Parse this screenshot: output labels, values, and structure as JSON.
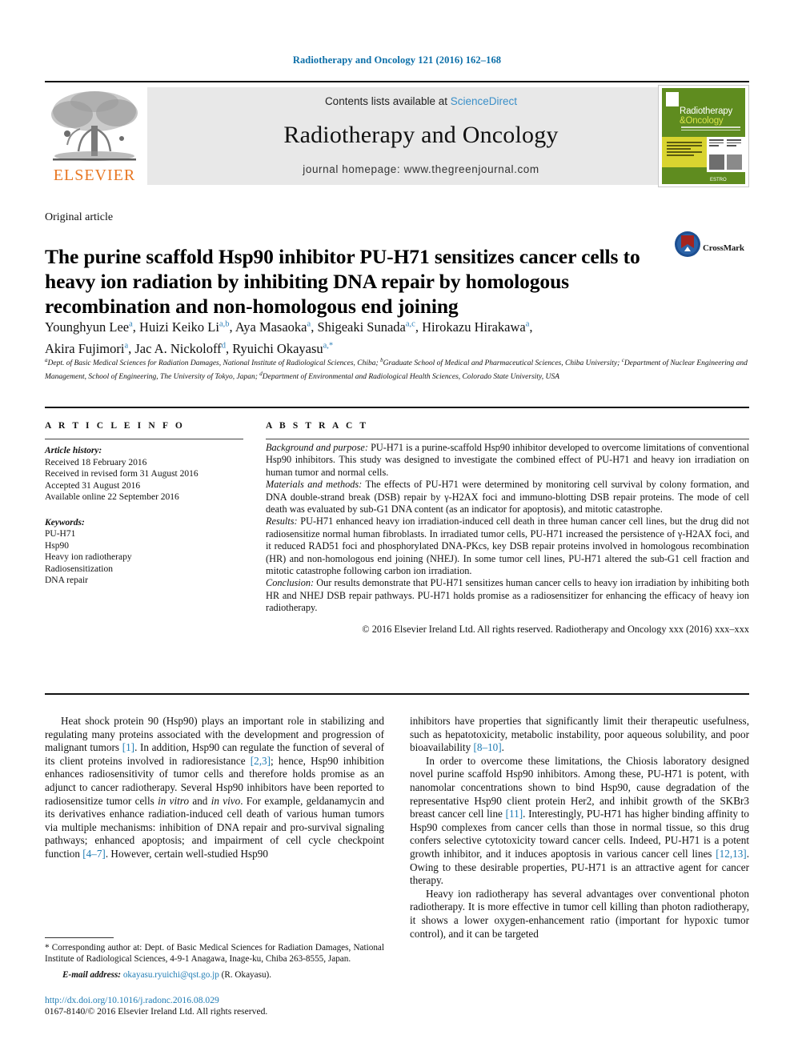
{
  "running_head": "Radiotherapy and Oncology 121 (2016) 162–168",
  "masthead": {
    "publisher_logo_label": "ELSEVIER",
    "contents_prefix": "Contents lists available at ",
    "contents_link": "ScienceDirect",
    "journal_title": "Radiotherapy and Oncology",
    "homepage": "journal homepage: www.thegreenjournal.com",
    "cover": {
      "line1": "Radiotherapy",
      "line2": "&Oncology",
      "footer": "ESTRO"
    }
  },
  "article": {
    "kind": "Original article",
    "title": "The purine scaffold Hsp90 inhibitor PU-H71 sensitizes cancer cells to heavy ion radiation by inhibiting DNA repair by homologous recombination and non-homologous end joining",
    "crossmark_label": "CrossMark",
    "authors_line1": "Younghyun Lee a, Huizi Keiko Li a,b, Aya Masaoka a, Shigeaki Sunada a,c, Hirokazu Hirakawa a,",
    "authors_line2": "Akira Fujimori a, Jac A. Nickoloff d, Ryuichi Okayasu a,*",
    "authors": [
      {
        "name": "Younghyun Lee",
        "marks": "a",
        "sep": ", "
      },
      {
        "name": "Huizi Keiko Li",
        "marks": "a,b",
        "sep": ", "
      },
      {
        "name": "Aya Masaoka",
        "marks": "a",
        "sep": ", "
      },
      {
        "name": "Shigeaki Sunada",
        "marks": "a,c",
        "sep": ", "
      },
      {
        "name": "Hirokazu Hirakawa",
        "marks": "a",
        "sep": ", "
      },
      {
        "name": "Akira Fujimori",
        "marks": "a",
        "sep": ", "
      },
      {
        "name": "Jac A. Nickoloff",
        "marks": "d",
        "sep": ", "
      },
      {
        "name": "Ryuichi Okayasu",
        "marks": "a,*",
        "sep": ""
      }
    ],
    "affiliations": [
      {
        "mark": "a",
        "text": "Dept. of Basic Medical Sciences for Radiation Damages, National Institute of Radiological Sciences, Chiba;"
      },
      {
        "mark": "b",
        "text": "Graduate School of Medical and Pharmaceutical Sciences, Chiba University;"
      },
      {
        "mark": "c",
        "text": "Department of Nuclear Engineering and Management, School of Engineering, The University of Tokyo, Japan;"
      },
      {
        "mark": "d",
        "text": "Department of Environmental and Radiological Health Sciences, Colorado State University, USA"
      }
    ]
  },
  "info": {
    "heading": "A R T I C L E   I N F O",
    "history_label": "Article history:",
    "history": [
      "Received 18 February 2016",
      "Received in revised form 31 August 2016",
      "Accepted 31 August 2016",
      "Available online 22 September 2016"
    ],
    "keywords_label": "Keywords:",
    "keywords": [
      "PU-H71",
      "Hsp90",
      "Heavy ion radiotherapy",
      "Radiosensitization",
      "DNA repair"
    ]
  },
  "abstract": {
    "heading": "A B S T R A C T",
    "background_label": "Background and purpose:",
    "background_text": " PU-H71 is a purine-scaffold Hsp90 inhibitor developed to overcome limitations of conventional Hsp90 inhibitors. This study was designed to investigate the combined effect of PU-H71 and heavy ion irradiation on human tumor and normal cells.",
    "methods_label": "Materials and methods:",
    "methods_text": " The effects of PU-H71 were determined by monitoring cell survival by colony formation, and DNA double-strand break (DSB) repair by γ-H2AX foci and immuno-blotting DSB repair proteins. The mode of cell death was evaluated by sub-G1 DNA content (as an indicator for apoptosis), and mitotic catastrophe.",
    "results_label": "Results:",
    "results_text": " PU-H71 enhanced heavy ion irradiation-induced cell death in three human cancer cell lines, but the drug did not radiosensitize normal human fibroblasts. In irradiated tumor cells, PU-H71 increased the persistence of γ-H2AX foci, and it reduced RAD51 foci and phosphorylated DNA-PKcs, key DSB repair proteins involved in homologous recombination (HR) and non-homologous end joining (NHEJ). In some tumor cell lines, PU-H71 altered the sub-G1 cell fraction and mitotic catastrophe following carbon ion irradiation.",
    "conclusion_label": "Conclusion:",
    "conclusion_text": " Our results demonstrate that PU-H71 sensitizes human cancer cells to heavy ion irradiation by inhibiting both HR and NHEJ DSB repair pathways. PU-H71 holds promise as a radiosensitizer for enhancing the efficacy of heavy ion radiotherapy.",
    "copyright": "© 2016 Elsevier Ireland Ltd. All rights reserved. Radiotherapy and Oncology xxx (2016) xxx–xxx"
  },
  "body": {
    "left": {
      "p1_a": "Heat shock protein 90 (Hsp90) plays an important role in stabilizing and regulating many proteins associated with the development and progression of malignant tumors ",
      "p1_ref1": "[1]",
      "p1_b": ". In addition, Hsp90 can regulate the function of several of its client proteins involved in radioresistance ",
      "p1_ref2": "[2,3]",
      "p1_c": "; hence, Hsp90 inhibition enhances radiosensitivity of tumor cells and therefore holds promise as an adjunct to cancer radiotherapy. Several Hsp90 inhibitors have been reported to radiosensitize tumor cells ",
      "p1_it1": "in vitro",
      "p1_d": " and ",
      "p1_it2": "in vivo",
      "p1_e": ". For example, geldanamycin and its derivatives enhance radiation-induced cell death of various human tumors via multiple mechanisms: inhibition of DNA repair and pro-survival signaling pathways; enhanced apoptosis; and impairment of cell cycle checkpoint function ",
      "p1_ref3": "[4–7]",
      "p1_f": ". However, certain well-studied Hsp90"
    },
    "right": {
      "p2_a": "inhibitors have properties that significantly limit their therapeutic usefulness, such as hepatotoxicity, metabolic instability, poor aqueous solubility, and poor bioavailability ",
      "p2_ref1": "[8–10]",
      "p2_b": ".",
      "p3_a": "In order to overcome these limitations, the Chiosis laboratory designed novel purine scaffold Hsp90 inhibitors. Among these, PU-H71 is potent, with nanomolar concentrations shown to bind Hsp90, cause degradation of the representative Hsp90 client protein Her2, and inhibit growth of the SKBr3 breast cancer cell line ",
      "p3_ref1": "[11]",
      "p3_b": ". Interestingly, PU-H71 has higher binding affinity to Hsp90 complexes from cancer cells than those in normal tissue, so this drug confers selective cytotoxicity toward cancer cells. Indeed, PU-H71 is a potent growth inhibitor, and it induces apoptosis in various cancer cell lines ",
      "p3_ref2": "[12,13]",
      "p3_c": ". Owing to these desirable properties, PU-H71 is an attractive agent for cancer therapy.",
      "p4": "Heavy ion radiotherapy has several advantages over conventional photon radiotherapy. It is more effective in tumor cell killing than photon radiotherapy, it shows a lower oxygen-enhancement ratio (important for hypoxic tumor control), and it can be targeted"
    }
  },
  "footnote": {
    "text": "* Corresponding author at: Dept. of Basic Medical Sciences for Radiation Damages, National Institute of Radiological Sciences, 4-9-1 Anagawa, Inage-ku, Chiba 263-8555, Japan.",
    "email_label": "E-mail address:",
    "email": "okayasu.ryuichi@qst.go.jp",
    "email_suffix": " (R. Okayasu)."
  },
  "footer": {
    "doi": "http://dx.doi.org/10.1016/j.radonc.2016.08.029",
    "issn_line": "0167-8140/© 2016 Elsevier Ireland Ltd. All rights reserved."
  },
  "colors": {
    "link_blue": "#1f7cb4",
    "elsevier_orange": "#E87722",
    "cover_green": "#5f8c1f",
    "cover_yellow": "#d9d430"
  }
}
